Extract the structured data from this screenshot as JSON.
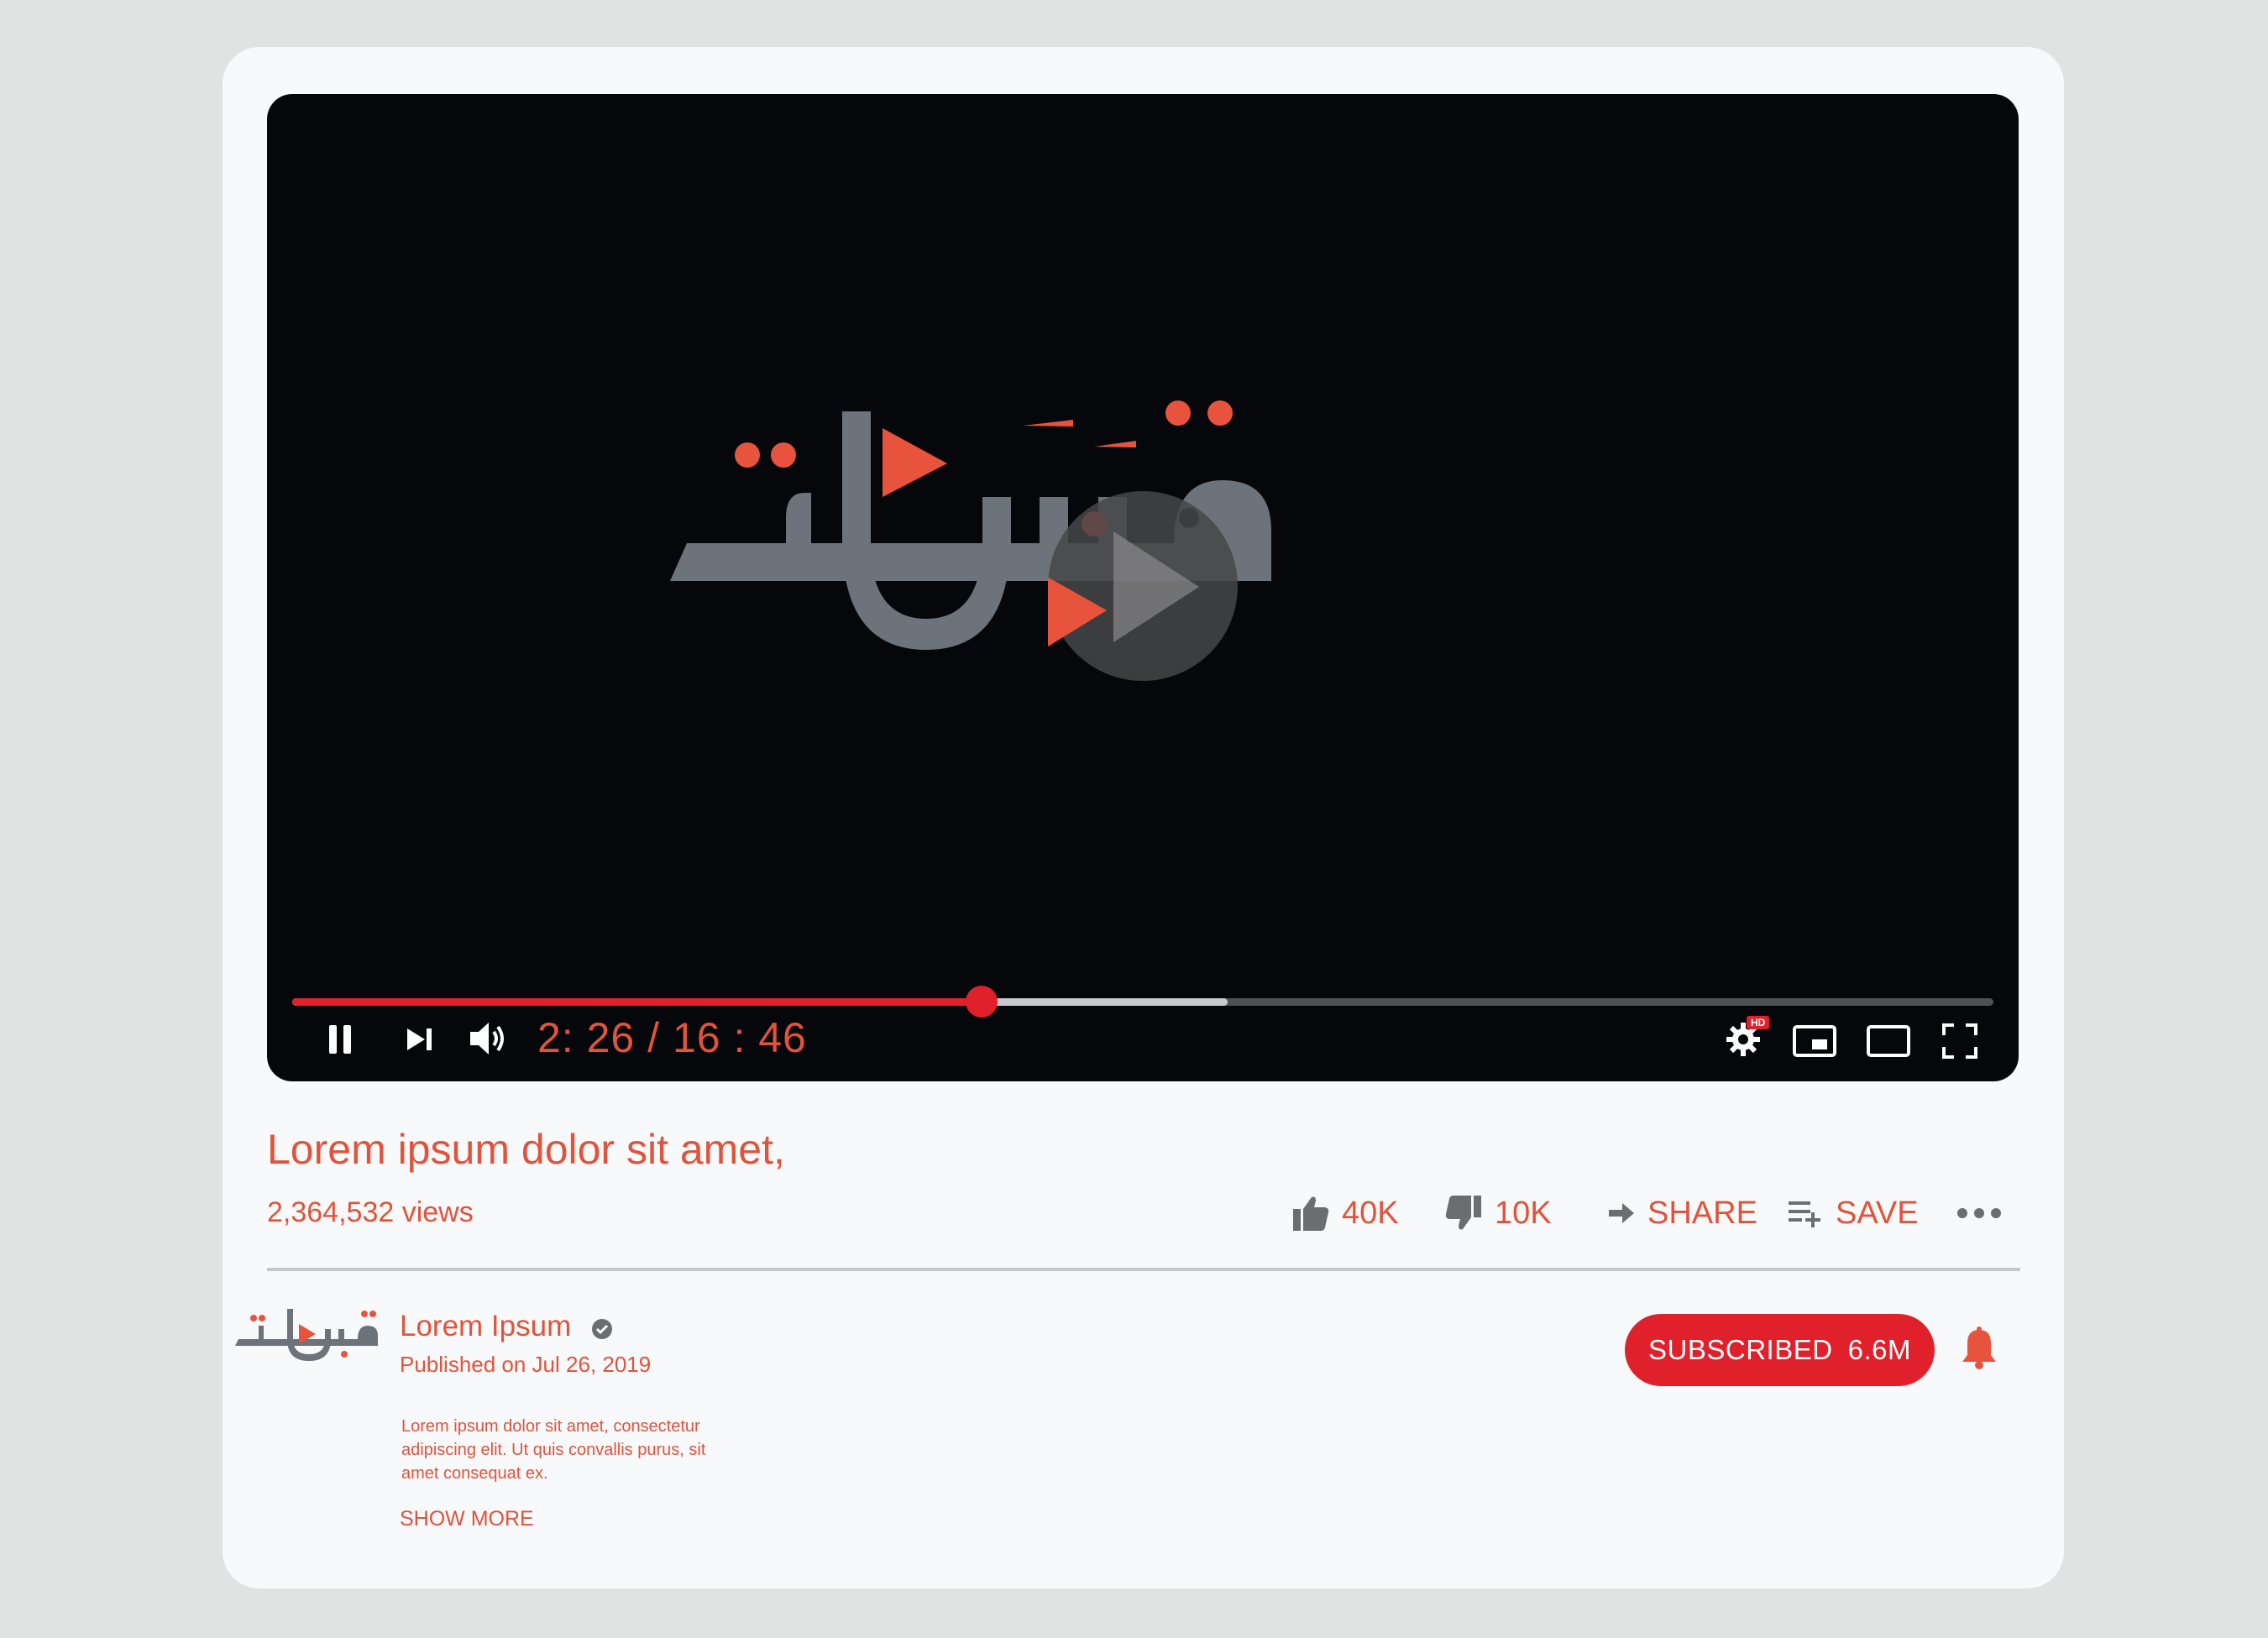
{
  "player": {
    "time_current": "2: 26",
    "time_separator": "/",
    "time_total": "16 : 46",
    "progress_played_fraction": 0.405,
    "progress_buffered_fraction": 0.55,
    "controls": [
      "pause-icon",
      "next-icon",
      "volume-icon",
      "settings-icon",
      "miniplayer-icon",
      "theater-icon",
      "fullscreen-icon"
    ],
    "settings_badge": "HD"
  },
  "video": {
    "title": "Lorem ipsum dolor sit amet,",
    "views": "2,364,532 views"
  },
  "actions": {
    "like_count": "40K",
    "dislike_count": "10K",
    "share_label": "SHARE",
    "save_label": "SAVE"
  },
  "channel": {
    "name": "Lorem Ipsum",
    "published": "Published on Jul 26, 2019",
    "description": "Lorem ipsum dolor sit amet, consectetur adipiscing elit. Ut quis convallis purus, sit amet consequat ex.",
    "show_more": "SHOW MORE",
    "subscribe_label": "SUBSCRIBED",
    "subscriber_count": "6.6M"
  },
  "colors": {
    "accent": "#e0533c",
    "brand_red": "#e0212b",
    "logo_gray": "#6c737a",
    "player_bg": "#06070a",
    "card_bg": "#f8f9fb",
    "page_bg": "#e1e3e2"
  }
}
